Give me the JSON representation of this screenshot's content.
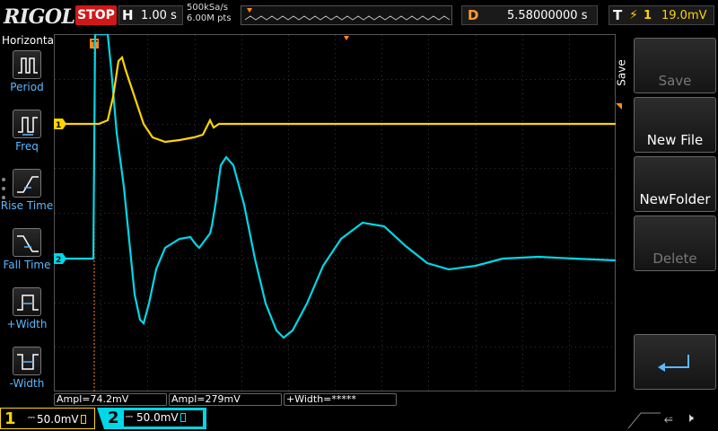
{
  "topbar": {
    "logo": "RIGOL",
    "run_state": "STOP",
    "timebase_label": "H",
    "timebase_value": "1.00 s",
    "sample_rate": "500kSa/s",
    "memory_depth": "6.00M pts",
    "trigger_marker": "T",
    "delay_label": "D",
    "delay_value": "5.58000000 s",
    "trigger_label": "T",
    "trigger_edge": "⚡",
    "trigger_source": "1",
    "trigger_level": "19.0mV"
  },
  "left_panel": {
    "title": "Horizontal",
    "items": [
      {
        "label": "Period",
        "icon": "period-icon"
      },
      {
        "label": "Freq",
        "icon": "freq-icon"
      },
      {
        "label": "Rise Time",
        "icon": "rise-time-icon"
      },
      {
        "label": "Fall Time",
        "icon": "fall-time-icon"
      },
      {
        "label": "+Width",
        "icon": "pos-width-icon"
      },
      {
        "label": "-Width",
        "icon": "neg-width-icon"
      }
    ]
  },
  "right_panel": {
    "title": "Save",
    "buttons": [
      {
        "label": "Save",
        "enabled": false
      },
      {
        "label": "New File",
        "enabled": true
      },
      {
        "label": "NewFolder",
        "enabled": true
      },
      {
        "label": "Delete",
        "enabled": false
      },
      {
        "label": "",
        "icon": "return-icon",
        "enabled": true
      }
    ]
  },
  "channels": {
    "ch1": {
      "number": "1",
      "scale": "50.0mV",
      "marker": "1",
      "color": "#ffd400"
    },
    "ch2": {
      "number": "2",
      "scale": "50.0mV",
      "marker": "2",
      "color": "#00d8e8"
    }
  },
  "measurements": [
    {
      "text": "Ampl=74.2mV"
    },
    {
      "text": "Ampl=279mV"
    },
    {
      "text": "+Width=*****"
    }
  ],
  "colors": {
    "ch1": "#ffd400",
    "ch2": "#00d8e8",
    "trigger": "#ff8a1c",
    "stop": "#d01818",
    "label": "#5bb8ff"
  },
  "status": {
    "usb_icon": "usb-icon",
    "speaker_icon": "speaker-muted-icon"
  }
}
